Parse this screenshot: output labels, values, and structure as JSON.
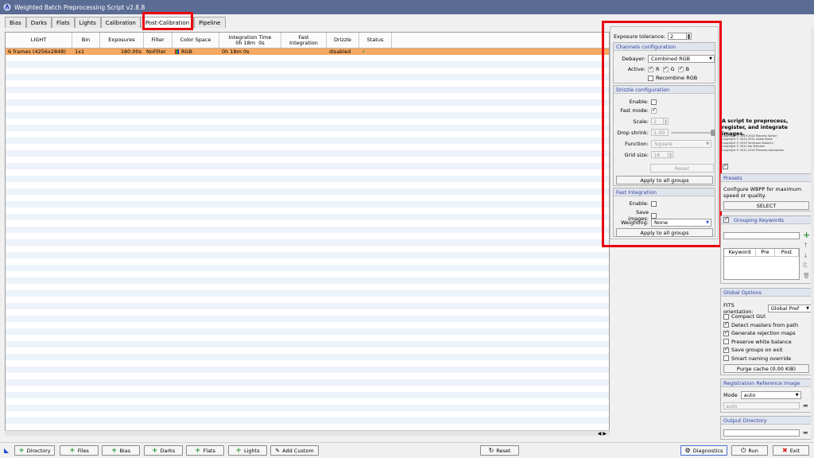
{
  "window": {
    "title": "Weighted Batch Preprocessing Script v2.8.8"
  },
  "tabs": [
    {
      "label": "Bias"
    },
    {
      "label": "Darks"
    },
    {
      "label": "Flats"
    },
    {
      "label": "Lights"
    },
    {
      "label": "Calibration"
    },
    {
      "label": "Post-Calibration"
    },
    {
      "label": "Pipeline"
    }
  ],
  "table": {
    "headers": [
      "LIGHT",
      "Bin",
      "Exposures",
      "Filter",
      "Color Space",
      "Integration Time\n0h 18m  0s",
      "Fast\nIntegration",
      "Drizzle",
      "Status"
    ],
    "rows": [
      {
        "light": "6 frames (4256x2848)",
        "bin": "1x1",
        "exposures": "180.00s",
        "filter": "NoFilter",
        "colorspace": "RGB",
        "integration": "0h 18m  0s",
        "fast": "",
        "drizzle": "disabled",
        "status": "✓"
      }
    ]
  },
  "post": {
    "exposure_label": "Exposure tolerance:",
    "exposure_value": "2",
    "channels_title": "Channels configuration",
    "debayer_label": "Debayer:",
    "debayer_value": "Combined RGB",
    "active_label": "Active:",
    "r": "R",
    "g": "G",
    "b": "B",
    "recombine": "Recombine RGB",
    "drizzle_title": "Drizzle configuration",
    "enable_label": "Enable:",
    "fastmode_label": "Fast mode:",
    "scale_label": "Scale:",
    "scale_value": "2",
    "shrink_label": "Drop shrink:",
    "shrink_value": "1.00",
    "function_label": "Function:",
    "function_value": "Square",
    "grid_label": "Grid size:",
    "grid_value": "16",
    "reset": "Reset",
    "apply1": "Apply to all groups",
    "fast_title": "Fast Integration",
    "fi_enable": "Enable:",
    "fi_save": "Save images:",
    "fi_weighting": "Weighting:",
    "fi_weighting_value": "None",
    "apply2": "Apply to all groups"
  },
  "side": {
    "desc": "A script to preprocess, register, and integrate images.",
    "copyright": [
      "Copyright © 2019-2020 Roberto Sartori",
      "Copyright © 2020-2021 Adam Block",
      "Copyright © 2019 Tommaso Rubechi",
      "Copyright © 2012 Kai Wiechen",
      "Copyright © 2012-2020 Pleiades Astrophoto"
    ],
    "presets_title": "Presets",
    "presets_text": "Configure WBPP for maximum speed or quality.",
    "select": "SELECT",
    "grouping_title": "Grouping Keywords",
    "kw_headers": [
      "Keyword",
      "Pre",
      "Post"
    ],
    "global_title": "Global Options",
    "fits_label": "FITS orientation:",
    "fits_value": "Global Pref",
    "options": [
      {
        "label": "Compact GUI",
        "on": false
      },
      {
        "label": "Detect masters from path",
        "on": true
      },
      {
        "label": "Generate rejection maps",
        "on": true
      },
      {
        "label": "Preserve white balance",
        "on": false
      },
      {
        "label": "Save groups on exit",
        "on": true
      },
      {
        "label": "Smart naming override",
        "on": false
      }
    ],
    "purge": "Purge cache (0.00 KiB)",
    "regref_title": "Registration Reference Image",
    "mode_label": "Mode",
    "mode_value": "auto",
    "ref_value": "auto",
    "output_title": "Output Directory"
  },
  "bottom": {
    "directory": "Directory",
    "files": "Files",
    "bias": "Bias",
    "darks": "Darks",
    "flats": "Flats",
    "lights": "Lights",
    "add_custom": "Add Custom",
    "reset": "Reset",
    "diagnostics": "Diagnostics",
    "run": "Run",
    "exit": "Exit"
  },
  "colors": {
    "accent_red": "#e8000f",
    "selected_row": "#f5a962",
    "title_bar": "#5b6c94"
  }
}
